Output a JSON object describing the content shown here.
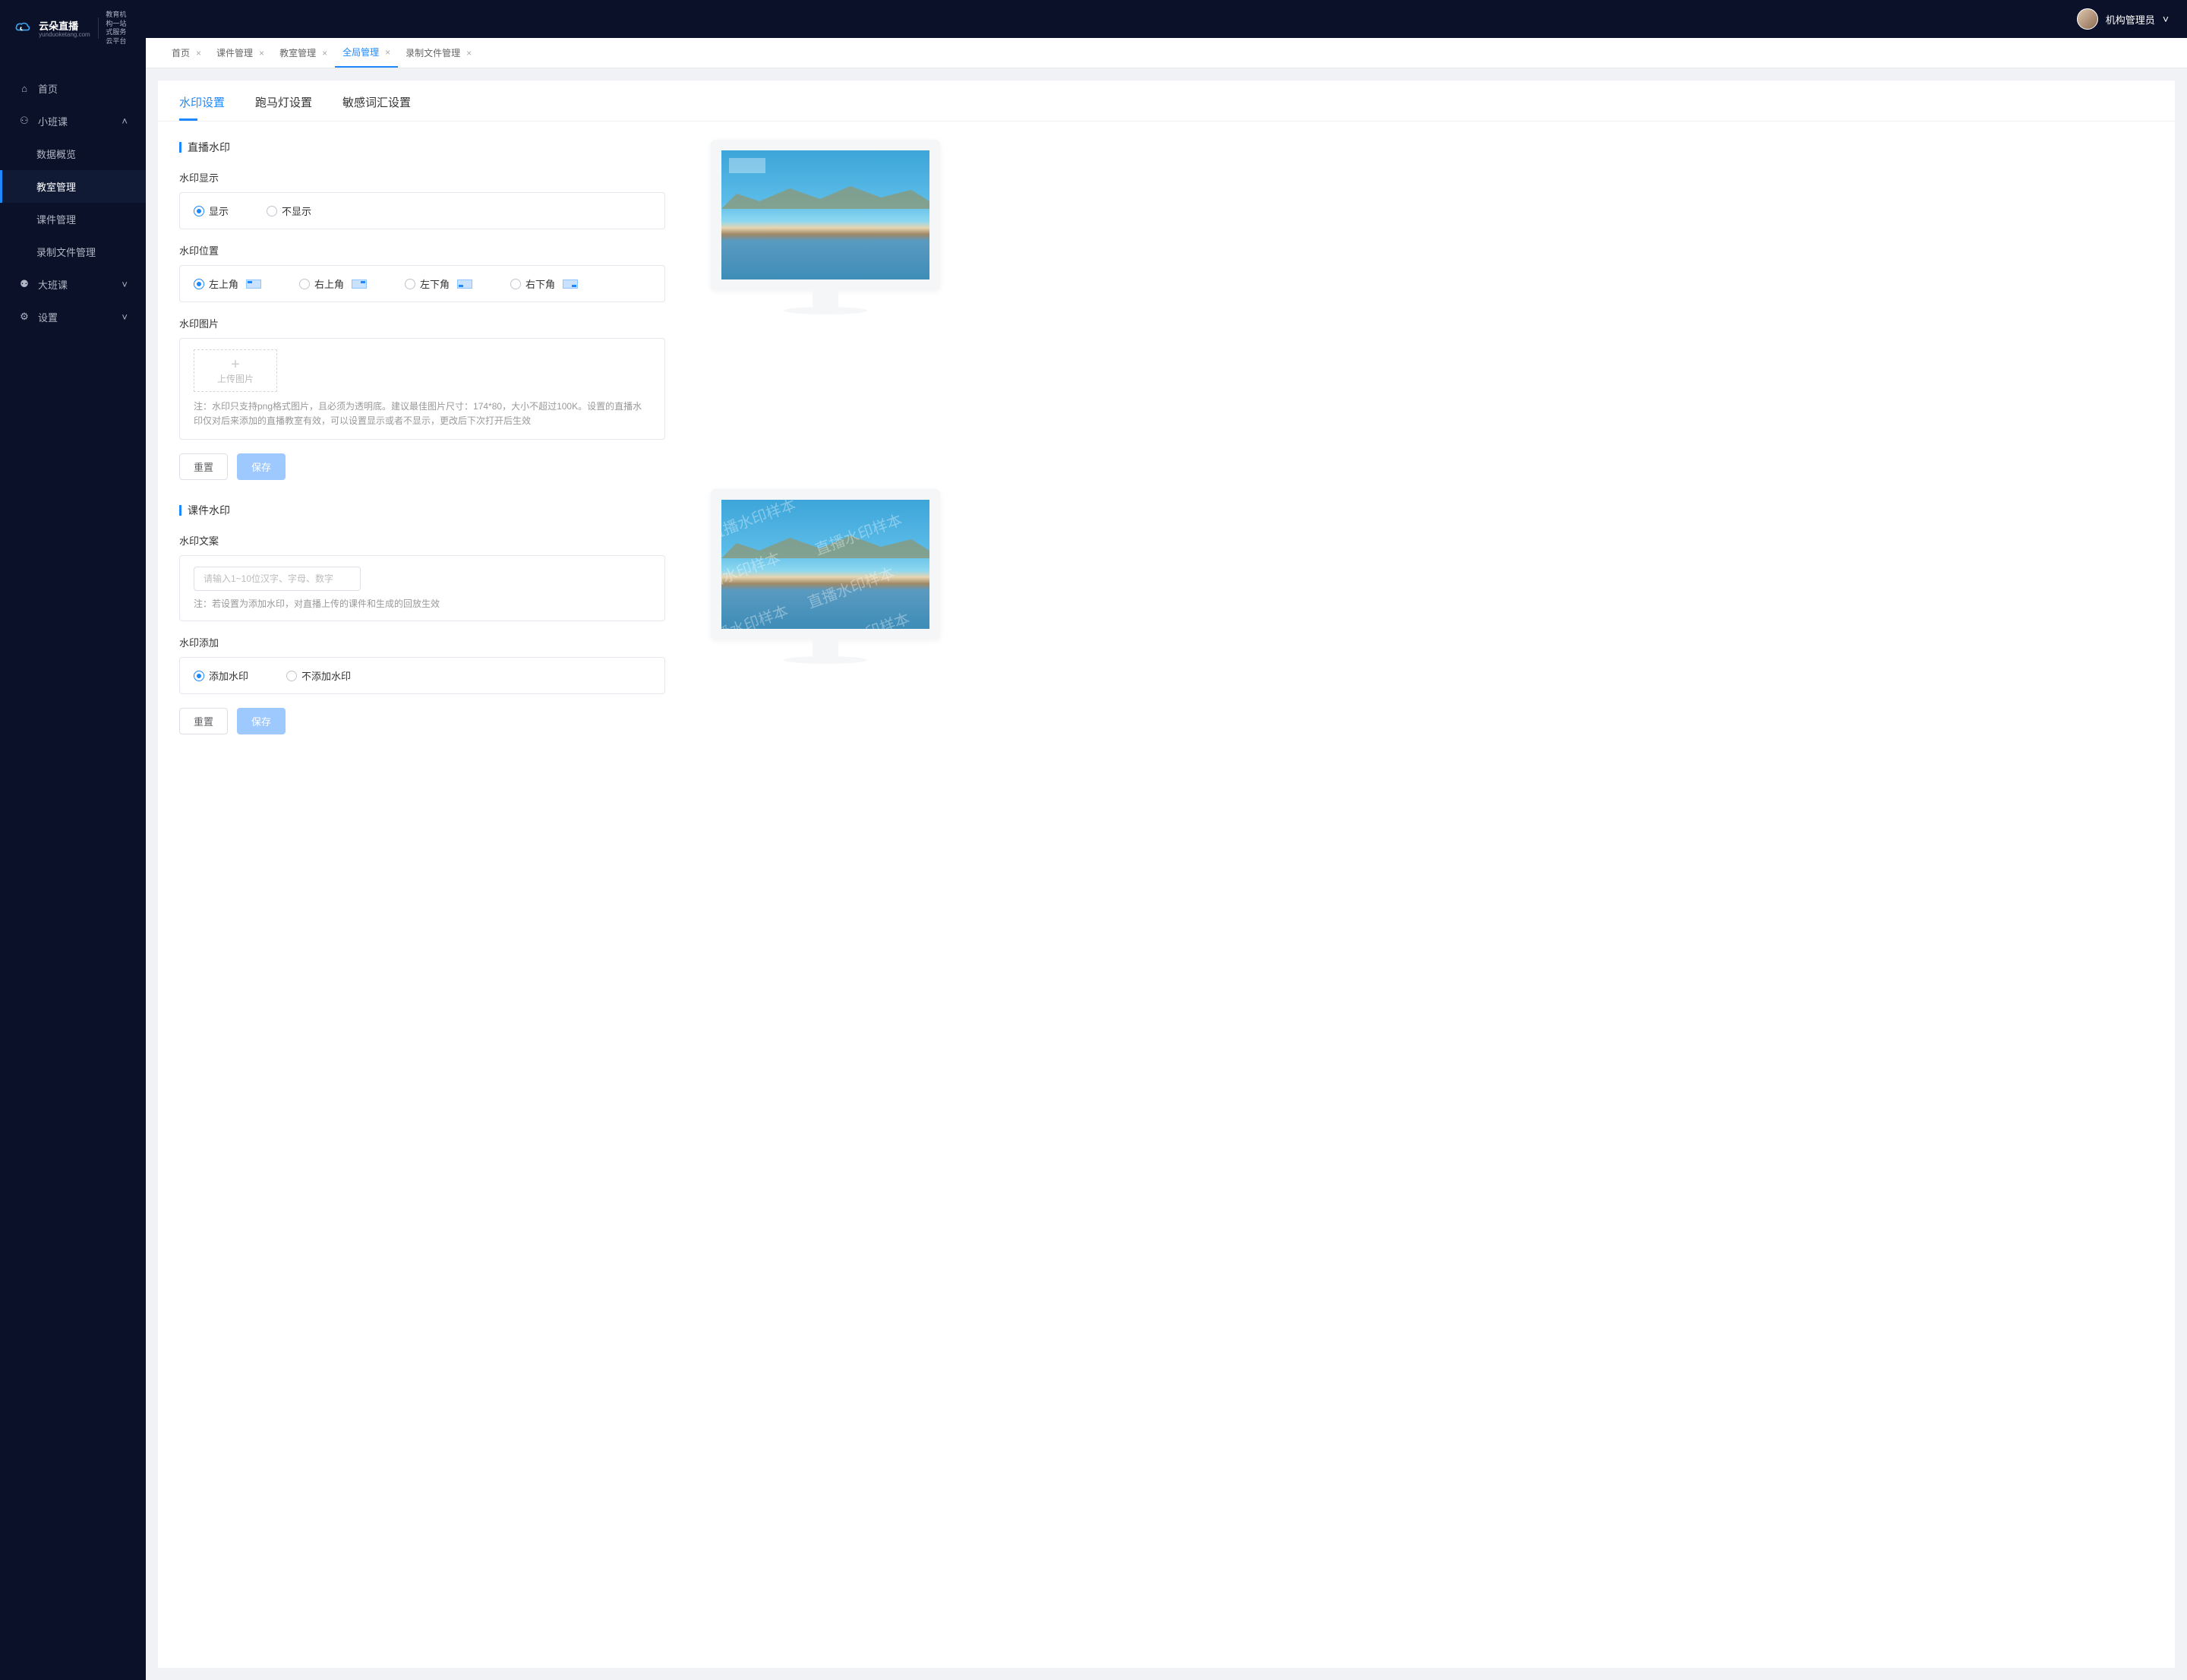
{
  "logo": {
    "main": "云朵直播",
    "sub": "yunduoketang.com",
    "tagline1": "教育机构一站",
    "tagline2": "式服务云平台"
  },
  "user": {
    "name": "机构管理员"
  },
  "nav": {
    "home": "首页",
    "smallClass": "小班课",
    "dataOverview": "数据概览",
    "classroomMgmt": "教室管理",
    "coursewareMgmt": "课件管理",
    "recordingMgmt": "录制文件管理",
    "bigClass": "大班课",
    "settings": "设置"
  },
  "tabs": {
    "home": "首页",
    "courseware": "课件管理",
    "classroom": "教室管理",
    "global": "全局管理",
    "recording": "录制文件管理"
  },
  "pageTabs": {
    "watermark": "水印设置",
    "marquee": "跑马灯设置",
    "sensitive": "敏感词汇设置"
  },
  "section1": {
    "title": "直播水印",
    "displayLabel": "水印显示",
    "show": "显示",
    "hide": "不显示",
    "positionLabel": "水印位置",
    "tl": "左上角",
    "tr": "右上角",
    "bl": "左下角",
    "br": "右下角",
    "imageLabel": "水印图片",
    "uploadText": "上传图片",
    "note": "注：水印只支持png格式图片，且必须为透明底。建议最佳图片尺寸：174*80，大小不超过100K。设置的直播水印仅对后来添加的直播教室有效，可以设置显示或者不显示，更改后下次打开后生效"
  },
  "section2": {
    "title": "课件水印",
    "textLabel": "水印文案",
    "placeholder": "请输入1~10位汉字、字母、数字",
    "note": "注：若设置为添加水印，对直播上传的课件和生成的回放生效",
    "addLabel": "水印添加",
    "add": "添加水印",
    "noAdd": "不添加水印"
  },
  "buttons": {
    "reset": "重置",
    "save": "保存"
  },
  "watermarkSample": "直播水印样本"
}
